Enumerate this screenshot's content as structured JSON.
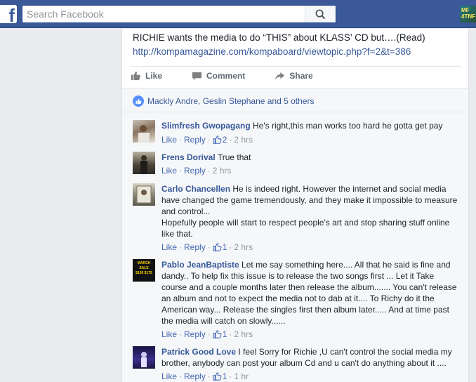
{
  "header": {
    "search_placeholder": "Search Facebook",
    "logo_letter": "f",
    "profile_avatar_text": "MF\n4TNF"
  },
  "post": {
    "text": "RICHIE wants the media to do “THIS” about KLASS’ CD but….(Read)",
    "link": "http://kompamagazine.com/kompaboard/viewtopic.php?f=2&t=386",
    "actions": [
      {
        "label": "Like",
        "icon": "thumbs-up-icon"
      },
      {
        "label": "Comment",
        "icon": "comment-icon"
      },
      {
        "label": "Share",
        "icon": "share-arrow-icon"
      }
    ],
    "reactions_text": "Mackly Andre, Geslin Stephane and 5 others"
  },
  "comments": [
    {
      "author": "Slimfresh Gwopagang",
      "text": "He's right,this man works too hard he gotta get pay",
      "like_label": "Like",
      "reply_label": "Reply",
      "likes": "2",
      "time": "2 hrs"
    },
    {
      "author": "Frens Dorival",
      "text": "True that",
      "like_label": "Like",
      "reply_label": "Reply",
      "likes": "",
      "time": "2 hrs"
    },
    {
      "author": "Carlo Chancellen",
      "text": "He is indeed right. However the internet and social media have changed the game tremendously, and they make it impossible to measure and control...",
      "text2": "Hopefully people will start to respect people's art and stop sharing stuff online like that.",
      "like_label": "Like",
      "reply_label": "Reply",
      "likes": "1",
      "time": "2 hrs"
    },
    {
      "author": "Pablo JeanBaptiste",
      "text": "Let me say something here.... All that he said is fine and dandy.. To help fix this issue is to release the two songs first ... Let it Take course and a couple months later then release the album....... You can't release an album and not to expect the media not to dab at it.... To Richy do it the American way... Release the singles first then album later..... And at time past the media will catch on slowly......",
      "avatar_text": "MARCH\nSALE\n$150 $175",
      "like_label": "Like",
      "reply_label": "Reply",
      "likes": "1",
      "time": "2 hrs"
    },
    {
      "author": "Patrick Good Love",
      "text": "I feel Sorry for Richie ,U can't control the social media my brother, anybody can post your album Cd and u can't do anything about it ....",
      "like_label": "Like",
      "reply_label": "Reply",
      "likes": "1",
      "time": "1 hr"
    }
  ],
  "colors": {
    "topbar": "#3b5998",
    "link": "#365899",
    "like_blue": "#5890ff",
    "muted": "#90949c"
  }
}
